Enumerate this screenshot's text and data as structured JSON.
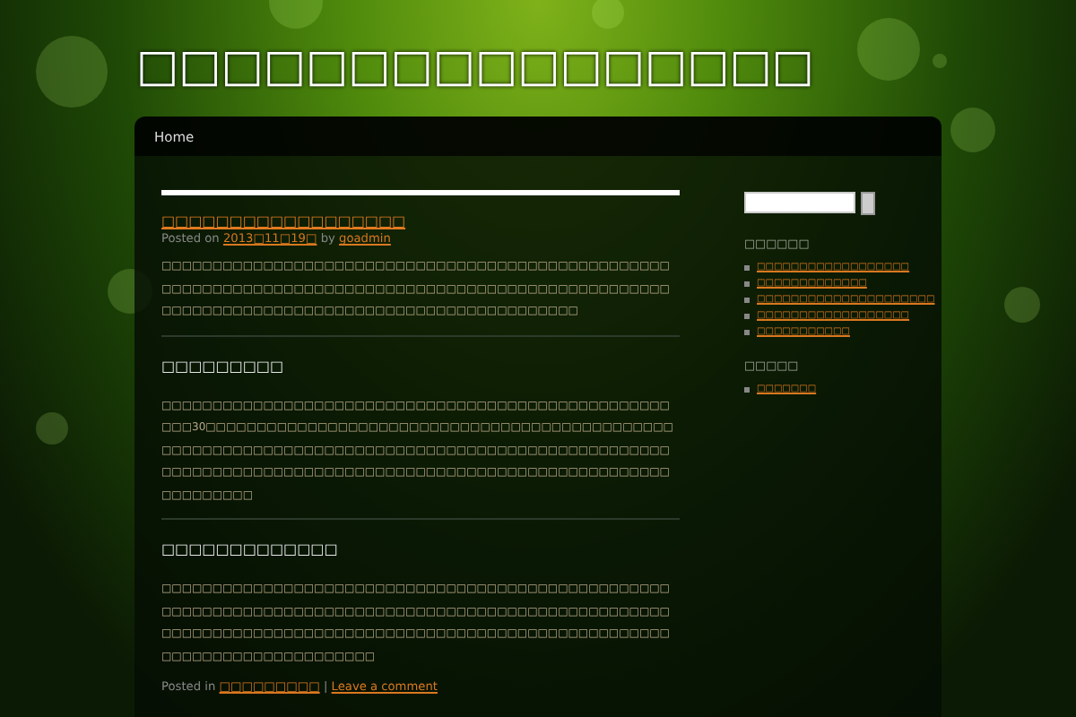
{
  "site": {
    "title": "□□□□□□□□□□□□□□□□"
  },
  "nav": {
    "items": [
      {
        "label": "Home",
        "selected": false
      }
    ]
  },
  "post": {
    "title": "□□□□□□□□□□□□□□□□□□",
    "meta": {
      "prefix": "Posted on",
      "date": "2013□11□19□",
      "by": "by",
      "author": "goadmin"
    },
    "sections": [
      {
        "kind": "paragraph",
        "text": "□□□□□□□□□□□□□□□□□□□□□□□□□□□□□□□□□□□□□□□□□□□□□□□□□□□□□□□□□□□□□□□□□□□□□□□□□□□□□□□□□□□□□□□□□□□□□□□□□□□□□□□□□□□□□□□□□□□□□□□□□□□□□□□□□□□□□□□□□□□□□"
      },
      {
        "kind": "divider"
      },
      {
        "kind": "heading",
        "text": "□□□□□□□□□"
      },
      {
        "kind": "paragraph",
        "text": "□□□□□□□□□□□□□□□□□□□□□□□□□□□□□□□□□□□□□□□□□□□□□□□□□□□□□30□□□□□□□□□□□□□□□□□□□□□□□□□□□□□□□□□□□□□□□□□□□□□□□□□□□□□□□□□□□□□□□□□□□□□□□□□□□□□□□□□□□□□□□□□□□□□□□□□□□□□□□□□□□□□□□□□□□□□□□□□□□□□□□□□□□□□□□□□□□□□□□□□□□□□□□□□□□"
      },
      {
        "kind": "divider"
      },
      {
        "kind": "heading",
        "text": "□□□□□□□□□□□□□"
      },
      {
        "kind": "paragraph",
        "text": "□□□□□□□□□□□□□□□□□□□□□□□□□□□□□□□□□□□□□□□□□□□□□□□□□□□□□□□□□□□□□□□□□□□□□□□□□□□□□□□□□□□□□□□□□□□□□□□□□□□□□□□□□□□□□□□□□□□□□□□□□□□□□□□□□□□□□□□□□□□□□□□□□□□□□□□□□□□□□□□□□□□□□□□□□□□"
      }
    ],
    "footer": {
      "prefix": "Posted in",
      "category": "□□□□□□□□□",
      "separator": "|",
      "comment_link": "Leave a comment"
    }
  },
  "sidebar": {
    "widgets": [
      {
        "title": "□□□□□□",
        "links": [
          "□□□□□□□□□□□□□□□□□□",
          "□□□□□□□□□□□□□",
          "□□□□□□□□□□□□□□□□□□□□□",
          "□□□□□□□□□□□□□□□□□□",
          "□□□□□□□□□□□"
        ]
      },
      {
        "title": "□□□□□",
        "links": [
          "□□□□□□□"
        ]
      }
    ]
  }
}
